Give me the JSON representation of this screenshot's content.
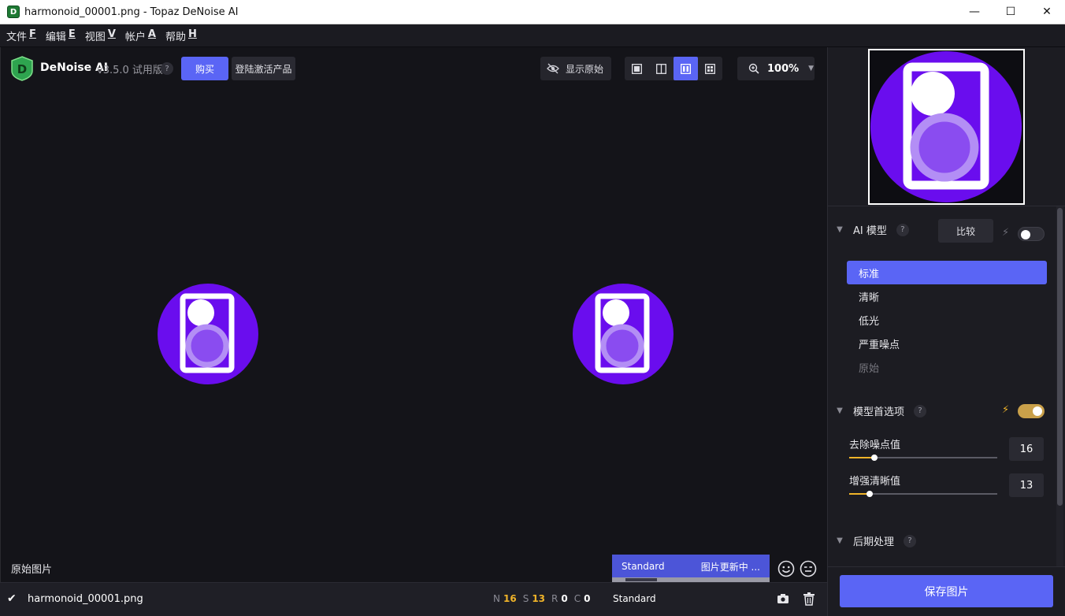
{
  "window": {
    "title": "harmonoid_00001.png - Topaz DeNoise AI",
    "app_icon_letter": "D",
    "controls": {
      "minimize": "—",
      "maximize": "☐",
      "close": "✕"
    }
  },
  "menu": [
    {
      "label": "文件",
      "key": "F"
    },
    {
      "label": "编辑",
      "key": "E"
    },
    {
      "label": "视图",
      "key": "V"
    },
    {
      "label": "帐户",
      "key": "A"
    },
    {
      "label": "帮助",
      "key": "H"
    }
  ],
  "toolbar": {
    "logo_letter": "D",
    "brand": "DeNoise AI",
    "version": "v3.5.0 试用版",
    "help": "?",
    "buy_label": "购买",
    "login_label": "登陆激活产品",
    "show_original_label": "显示原始",
    "view_modes": [
      "single-view-icon",
      "split-view-icon",
      "side-by-side-view-icon",
      "grid-view-icon"
    ],
    "active_view_index": 2,
    "zoom_label": "100%"
  },
  "canvas": {
    "original_label": "原始图片",
    "status_model": "Standard",
    "status_message": "图片更新中 ...",
    "progress": 0.2
  },
  "filmstrip": {
    "filename": "harmonoid_00001.png",
    "stats": [
      {
        "key": "N",
        "value": "16",
        "highlight": true
      },
      {
        "key": "S",
        "value": "13",
        "highlight": true
      },
      {
        "key": "R",
        "value": "0",
        "highlight": false
      },
      {
        "key": "C",
        "value": "0",
        "highlight": false
      }
    ],
    "model": "Standard"
  },
  "panel": {
    "ai_model": {
      "title": "AI 模型",
      "help": "?",
      "compare_label": "比较",
      "auto_enabled": false,
      "options": [
        {
          "label": "标准",
          "state": "active"
        },
        {
          "label": "清晰",
          "state": "normal"
        },
        {
          "label": "低光",
          "state": "normal"
        },
        {
          "label": "严重噪点",
          "state": "normal"
        },
        {
          "label": "原始",
          "state": "disabled"
        }
      ]
    },
    "model_prefs": {
      "title": "模型首选项",
      "help": "?",
      "auto_enabled": true,
      "sliders": [
        {
          "label": "去除噪点值",
          "value": "16",
          "fraction": 0.17
        },
        {
          "label": "增强清晰值",
          "value": "13",
          "fraction": 0.14
        }
      ]
    },
    "post_processing": {
      "title": "后期处理",
      "help": "?"
    },
    "save_label": "保存图片"
  },
  "colors": {
    "accent": "#5a65f5",
    "warning": "#f0b429",
    "image_purple": "#6a0dee"
  }
}
